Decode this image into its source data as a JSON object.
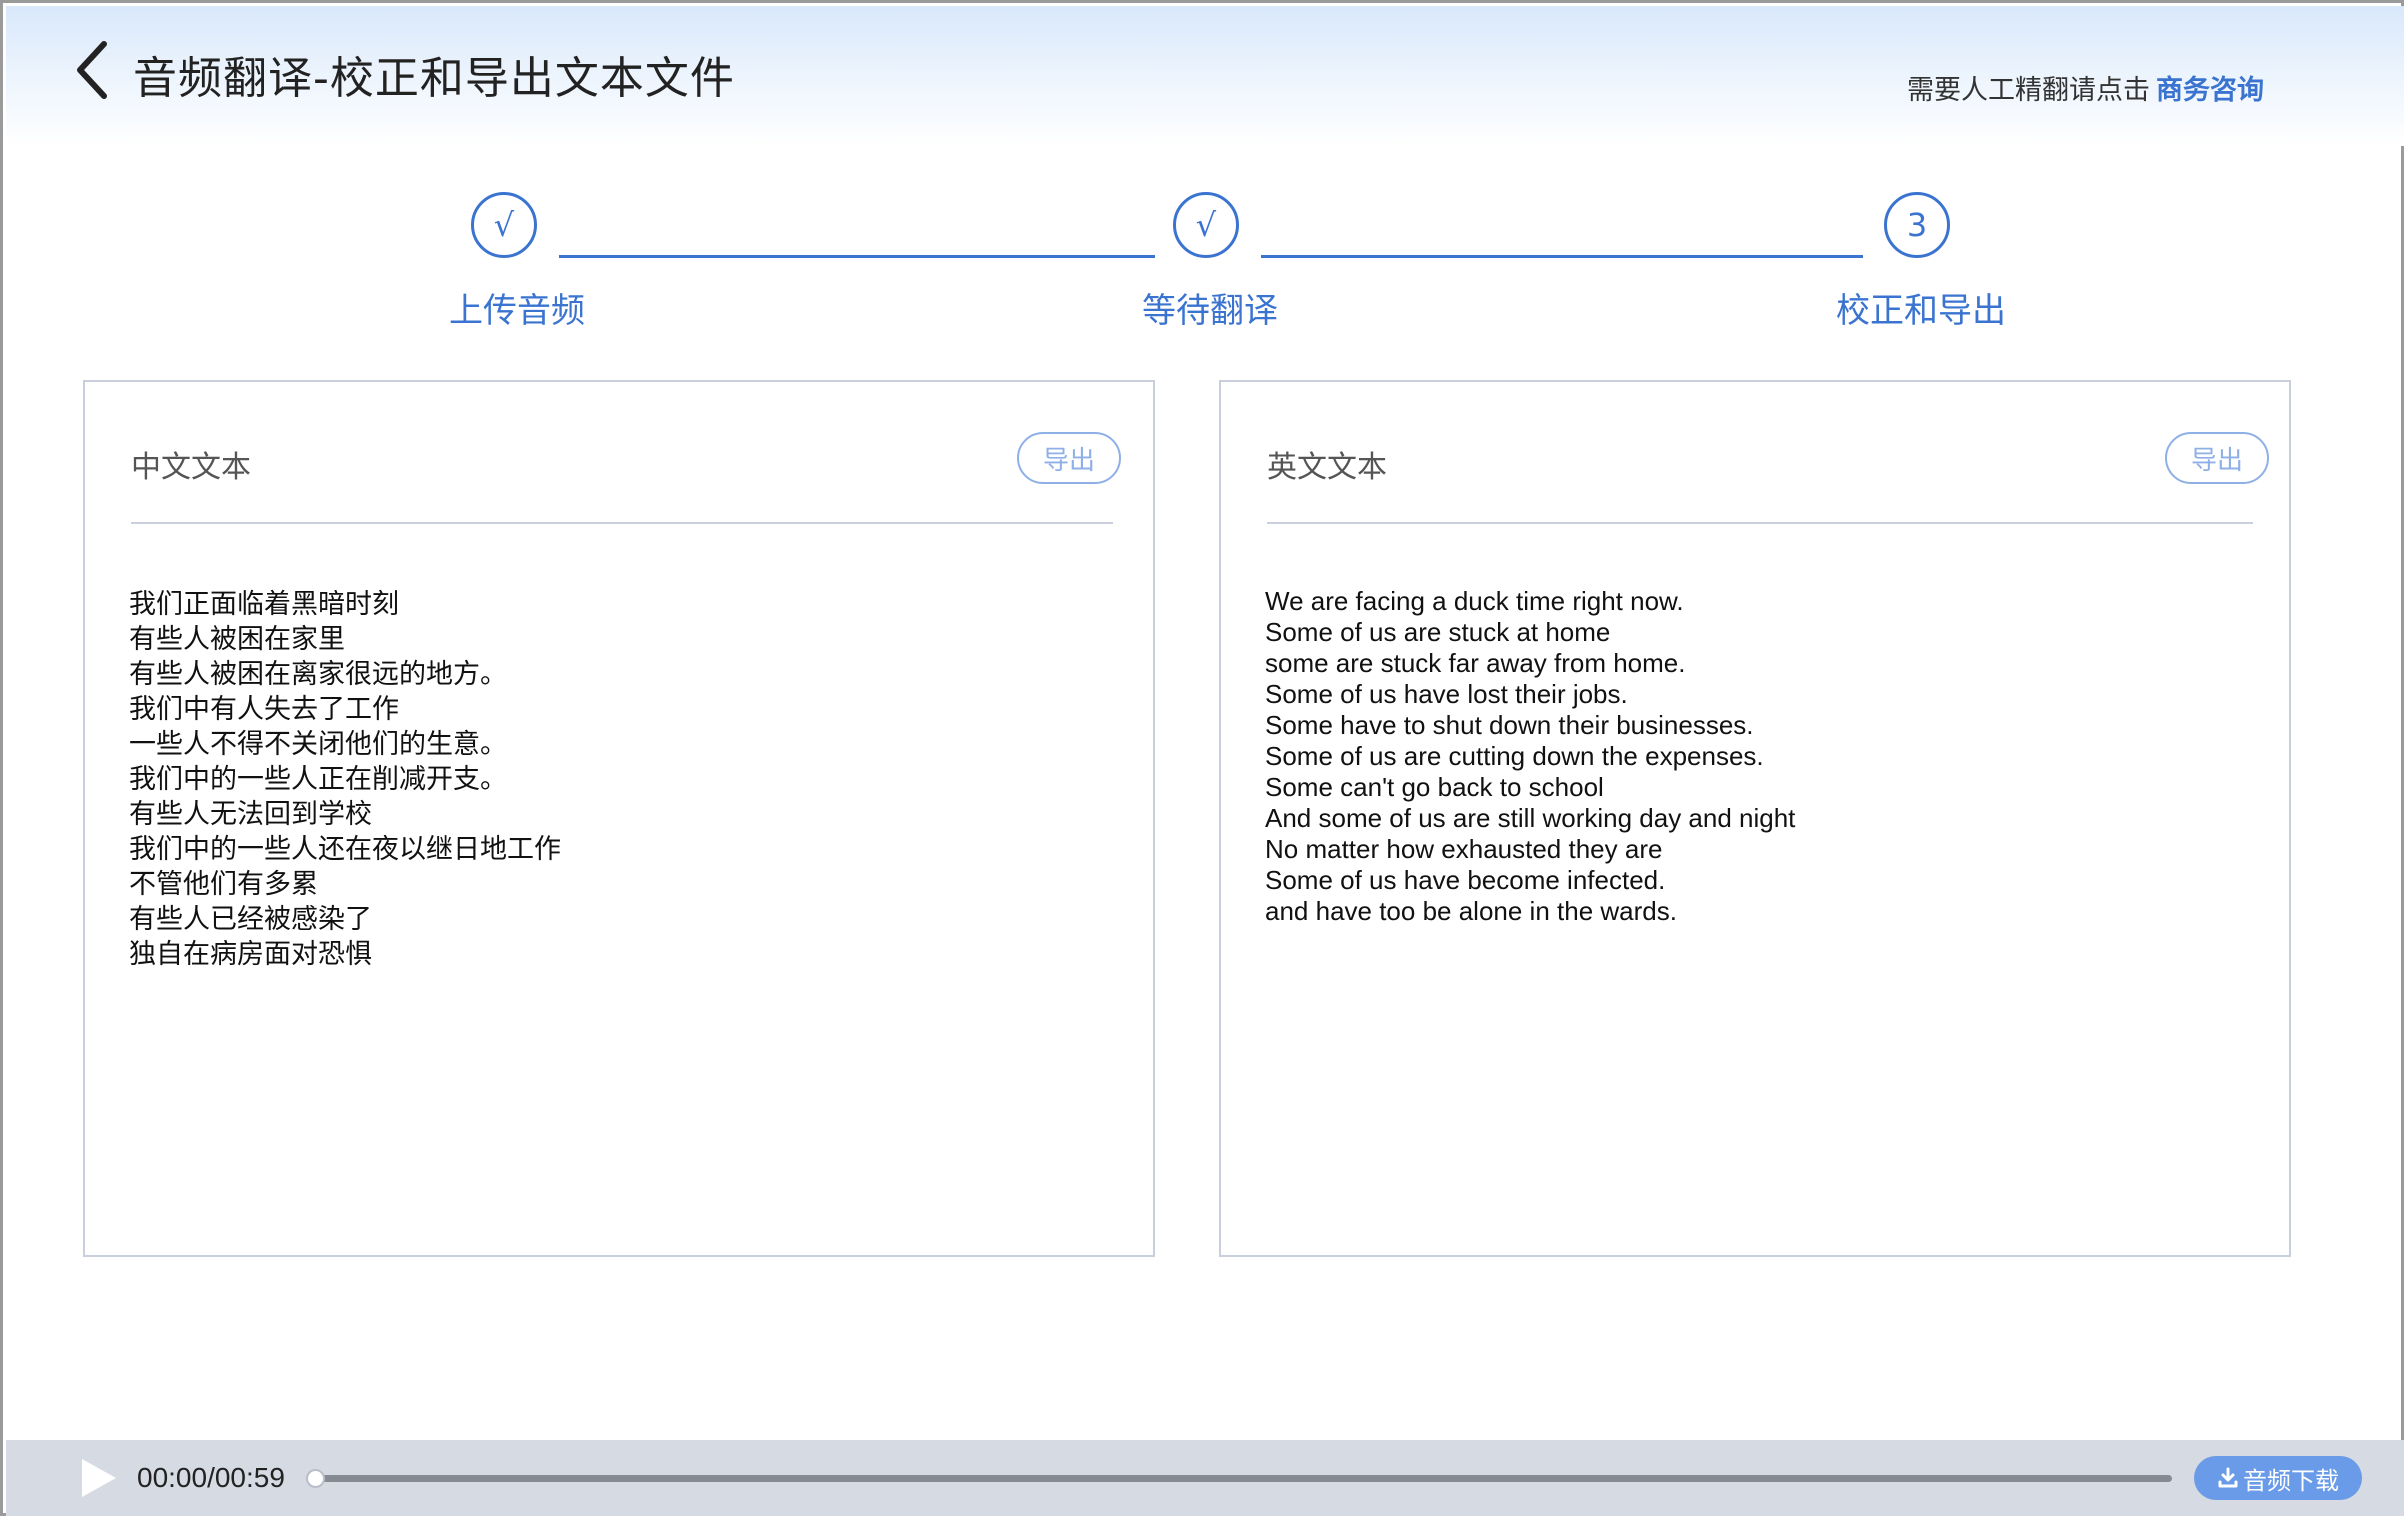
{
  "header": {
    "title": "音频翻译-校正和导出文本文件",
    "prompt_text": "需要人工精翻请点击",
    "consult_link": "商务咨询"
  },
  "steps": [
    {
      "marker": "√",
      "label": "上传音频"
    },
    {
      "marker": "√",
      "label": "等待翻译"
    },
    {
      "marker": "3",
      "label": "校正和导出"
    }
  ],
  "panels": {
    "chinese": {
      "title": "中文文本",
      "export_label": "导出",
      "lines": [
        "我们正面临着黑暗时刻",
        "有些人被困在家里",
        "有些人被困在离家很远的地方。",
        "我们中有人失去了工作",
        "一些人不得不关闭他们的生意。",
        "我们中的一些人正在削减开支。",
        "有些人无法回到学校",
        "我们中的一些人还在夜以继日地工作",
        "不管他们有多累",
        "有些人已经被感染了",
        "独自在病房面对恐惧"
      ]
    },
    "english": {
      "title": "英文文本",
      "export_label": "导出",
      "lines": [
        "We are facing a duck time right now.",
        "Some of us are stuck at home",
        "some are stuck far away from home.",
        "Some of us have lost their jobs.",
        "Some have to shut down their businesses.",
        "Some of us are cutting down the expenses.",
        "Some can't go back to school",
        "And some of us are still working day and night",
        "No matter how exhausted they are",
        "Some of us have become infected.",
        "and have too be alone in the wards."
      ]
    }
  },
  "player": {
    "time": "00:00/00:59",
    "progress": 0.0,
    "download_label": "音频下载"
  },
  "colors": {
    "accent": "#3a74d0",
    "export_border": "#8fb0e6",
    "player_bg": "#d6dae3",
    "download_bg": "#6a9be8"
  },
  "icons": {
    "back": "chevron-left-icon",
    "play": "play-icon",
    "download": "download-icon"
  }
}
